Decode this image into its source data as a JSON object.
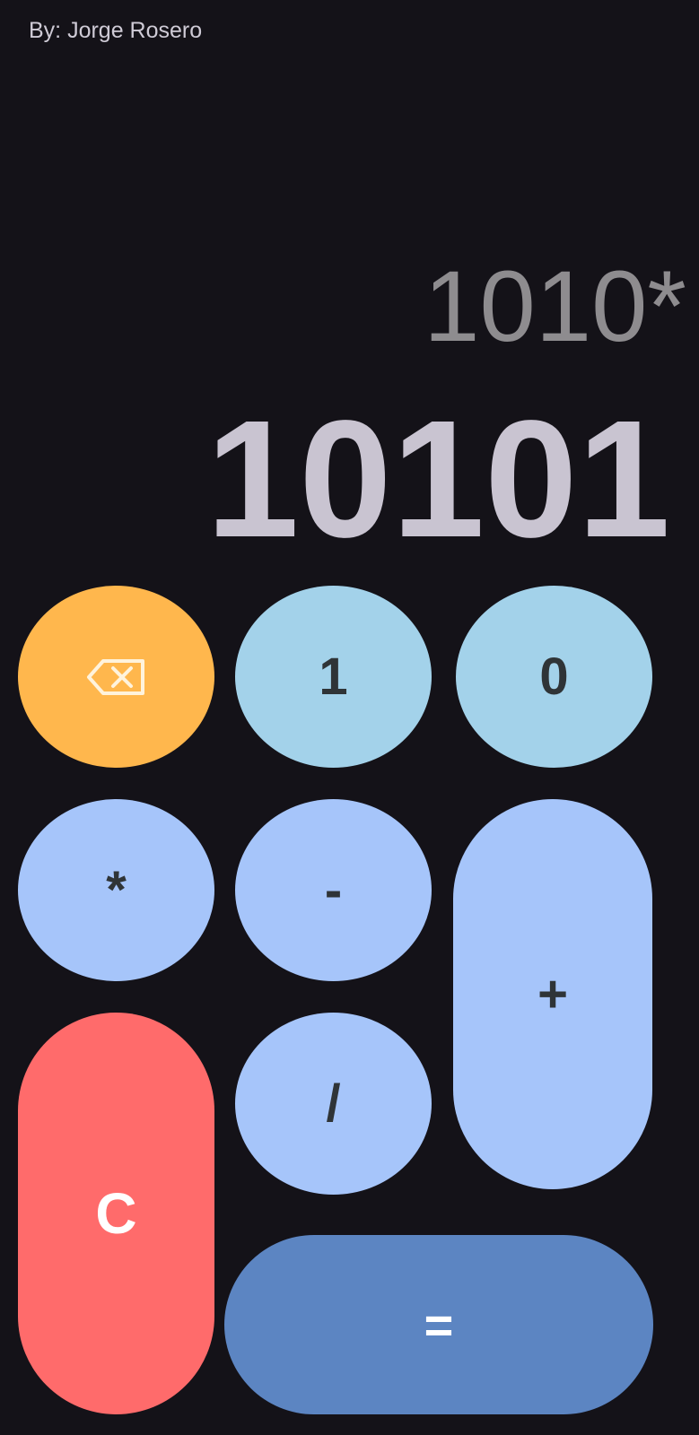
{
  "header": {
    "author": "By: Jorge Rosero"
  },
  "display": {
    "expression": "1010*",
    "result": "10101"
  },
  "keypad": {
    "backspace_icon": "backspace-icon",
    "one": "1",
    "zero": "0",
    "multiply": "*",
    "subtract": "-",
    "add": "+",
    "divide": "/",
    "clear": "C",
    "equals": "="
  },
  "colors": {
    "background": "#141218",
    "backspace": "#FFB74D",
    "digit": "#A3D2EA",
    "operator": "#A6C5FA",
    "clear": "#FF6B6B",
    "equals": "#5C85C2"
  }
}
